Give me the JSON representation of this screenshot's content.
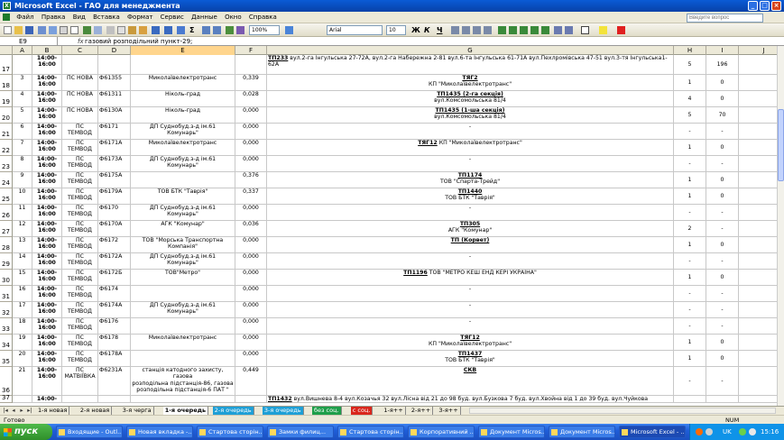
{
  "window": {
    "title": "Microsoft Excel - ГАО для менеджмента",
    "min_glyph": "_",
    "max_glyph": "□",
    "close_glyph": "×"
  },
  "menu": {
    "items": [
      "Файл",
      "Правка",
      "Вид",
      "Вставка",
      "Формат",
      "Сервис",
      "Данные",
      "Окно",
      "Справка"
    ],
    "help_placeholder": "Введите вопрос"
  },
  "toolbar": {
    "zoom": "100%",
    "font_name": "Arial",
    "font_size": "10",
    "bold": "Ж",
    "italic": "К",
    "underline": "Ч"
  },
  "formula_bar": {
    "cell_ref": "E9",
    "fx": "fx",
    "formula": "газовий розподільний пункт-29;"
  },
  "columns": [
    "A",
    "B",
    "C",
    "D",
    "E",
    "F",
    "G",
    "H",
    "I",
    "J"
  ],
  "selected_column": "E",
  "rows": [
    {
      "n": "17",
      "a": "",
      "b": "14:00-\n16:00",
      "c": "",
      "d": "",
      "e": "",
      "f": "",
      "g_b": "ТП233",
      "g": " вул.2-га Інгульська 27-72А, вул.2-га Набережна 2-81 вул.6-та Інгульська 61-71А вул.Пехлромівська 47-51 вул.3-тя Інгульська1-62А",
      "h": "5",
      "i": "196"
    },
    {
      "n": "18",
      "a": "3",
      "b": "14:00-\n16:00",
      "c": "ПС НОВА",
      "d": "Ф61355",
      "e": "Миколаївелектротранс",
      "f": "0,339",
      "g_b": "ТЯГ2",
      "g": "КП \"Миколаївелектротранс\"",
      "h": "1",
      "i": "0"
    },
    {
      "n": "19",
      "a": "4",
      "b": "14:00-\n16:00",
      "c": "ПС НОВА",
      "d": "Ф61311",
      "e": "Ніколь-град",
      "f": "0,028",
      "g_b": "ТП1435 (2-га секція)",
      "g": "вул.Комсомольська 81/4",
      "h": "4",
      "i": "0"
    },
    {
      "n": "20",
      "a": "5",
      "b": "14:00-\n16:00",
      "c": "ПС НОВА",
      "d": "Ф6130А",
      "e": "Ніколь-град",
      "f": "0,000",
      "g_b": "ТП1435 (1-ша секція)",
      "g": "вул.Комсомольська 81/4",
      "h": "5",
      "i": "70"
    },
    {
      "n": "21",
      "a": "6",
      "b": "14:00-\n16:00",
      "c": "ПС\nТЕМВОД",
      "d": "Ф6171",
      "e": "ДП Суднобуд.з-д ім.61\nКомунарь\"",
      "f": "0,000",
      "g_b": "",
      "g": "-",
      "h": "-",
      "i": "-"
    },
    {
      "n": "22",
      "a": "7",
      "b": "14:00-\n16:00",
      "c": "ПС\nТЕМВОД",
      "d": "Ф6171А",
      "e": "Миколаївелектротранс",
      "f": "0,000",
      "g_b": "ТЯГ12",
      "g": " КП \"Миколаївелектротранс\"",
      "h": "1",
      "i": "0"
    },
    {
      "n": "23",
      "a": "8",
      "b": "14:00-\n16:00",
      "c": "ПС\nТЕМВОД",
      "d": "Ф6173А",
      "e": "ДП Суднобуд.з-д ім.61\nКомунарь\"",
      "f": "0,000",
      "g_b": "",
      "g": "-",
      "h": "-",
      "i": "-"
    },
    {
      "n": "24",
      "a": "9",
      "b": "14:00-\n16:00",
      "c": "ПС\nТЕМВОД",
      "d": "Ф6175А",
      "e": "",
      "f": "0,376",
      "g_b": "ТП1174",
      "g": "ТОВ \"Спарта-Трейд\"",
      "h": "1",
      "i": "0"
    },
    {
      "n": "25",
      "a": "10",
      "b": "14:00-\n16:00",
      "c": "ПС\nТЕМВОД",
      "d": "Ф6179А",
      "e": "ТОВ БТК \"Таврія\"",
      "f": "0,337",
      "g_b": "ТП1440",
      "g": "ТОВ БТК \"Таврія\"",
      "h": "1",
      "i": "0"
    },
    {
      "n": "26",
      "a": "11",
      "b": "14:00-\n16:00",
      "c": "ПС\nТЕМВОД",
      "d": "Ф6170",
      "e": "ДП Суднобуд.з-д ім.61\nКомунарь\"",
      "f": "0,000",
      "g_b": "",
      "g": "-",
      "h": "-",
      "i": "-"
    },
    {
      "n": "27",
      "a": "12",
      "b": "14:00-\n16:00",
      "c": "ПС\nТЕМВОД",
      "d": "Ф6170А",
      "e": "АГК \"Комунар\"",
      "f": "0,036",
      "g_b": "ТП305",
      "g": "АГК \"Комунар\"",
      "h": "2",
      "i": "-"
    },
    {
      "n": "28",
      "a": "13",
      "b": "14:00-\n16:00",
      "c": "ПС\nТЕМВОД",
      "d": "Ф6172",
      "e": "ТОВ \"Морська Транспортна\nКомпанія\"",
      "f": "0,000",
      "g_b": "ТП (Корвет)",
      "g": "",
      "h": "1",
      "i": "0"
    },
    {
      "n": "29",
      "a": "14",
      "b": "14:00-\n16:00",
      "c": "ПС\nТЕМВОД",
      "d": "Ф6172А",
      "e": "ДП Суднобуд.з-д ім.61\nКомунарь\"",
      "f": "0,000",
      "g_b": "",
      "g": "-",
      "h": "-",
      "i": "-"
    },
    {
      "n": "30",
      "a": "15",
      "b": "14:00-\n16:00",
      "c": "ПС\nТЕМВОД",
      "d": "Ф6172Б",
      "e": "ТОВ\"Метро\"",
      "f": "0,000",
      "g_b": "ТП1196",
      "g": " ТОВ \"МЕТРО КЕШ ЕНД КЕРІ УКРАЇНА\"",
      "h": "1",
      "i": "0"
    },
    {
      "n": "31",
      "a": "16",
      "b": "14:00-\n16:00",
      "c": "ПС\nТЕМВОД",
      "d": "Ф6174",
      "e": "",
      "f": "0,000",
      "g_b": "",
      "g": "-",
      "h": "-",
      "i": "-"
    },
    {
      "n": "32",
      "a": "17",
      "b": "14:00-\n16:00",
      "c": "ПС\nТЕМВОД",
      "d": "Ф6174А",
      "e": "ДП Суднобуд.з-д ім.61\nКомунарь\"",
      "f": "0,000",
      "g_b": "",
      "g": "-",
      "h": "-",
      "i": "-"
    },
    {
      "n": "33",
      "a": "18",
      "b": "14:00-\n16:00",
      "c": "ПС\nТЕМВОД",
      "d": "Ф6176",
      "e": "",
      "f": "0,000",
      "g_b": "",
      "g": "-",
      "h": "-",
      "i": "-"
    },
    {
      "n": "34",
      "a": "19",
      "b": "14:00-\n16:00",
      "c": "ПС\nТЕМВОД",
      "d": "Ф6178",
      "e": "Миколаївелектротранс",
      "f": "0,000",
      "g_b": "ТЯГ12",
      "g": "КП \"Миколаївелектротранс\"",
      "h": "1",
      "i": "0"
    },
    {
      "n": "35",
      "a": "20",
      "b": "14:00-\n16:00",
      "c": "ПС\nТЕМВОД",
      "d": "Ф6178А",
      "e": "",
      "f": "0,000",
      "g_b": "ТП1437",
      "g": "ТОВ БТК \"Таврія\"",
      "h": "1",
      "i": "0"
    },
    {
      "n": "36",
      "a": "21",
      "b": "14:00-\n16:00",
      "c": "ПС\nМАТВІЇВКА",
      "d": "Ф6231А",
      "e": "станція катодного захисту, газова\nрозподільна підстанція-86, газова\nрозподільна підстанція-6 ПАТ \"",
      "f": "0,449",
      "g_b": "СКВ",
      "g": "",
      "h": "-",
      "i": "-"
    },
    {
      "n": "37",
      "a": "",
      "b": "14:00-",
      "c": "",
      "d": "",
      "e": "",
      "f": "",
      "g_b": "ТП1432",
      "g": " вул.Вишнева 8-4 вул.Козачья 32 вул.Лісна від 21 до 98 буд. вул.Бузкова 7 буд. вул.Хвойна від 1 до 39 буд. вул.Чуйкова",
      "h": "",
      "i": ""
    }
  ],
  "sheet_tabs": [
    "1-я новая",
    "2-я новая",
    "3-я черга",
    "1-я очередь",
    "2-я очередь",
    "3-я очередь",
    "без соц.",
    "с соц.",
    "1-я++",
    "2-я++",
    "3-я++"
  ],
  "active_tab": "1-я очередь",
  "tab_colors": {
    "2-я очередь": "#1e9fd6",
    "3-я очередь": "#1e9fd6",
    "без соц.": "#1e9e4a",
    "с соц.": "#d9261c"
  },
  "status": {
    "left": "Готово",
    "num": "NUM"
  },
  "taskbar": {
    "start": "пуск",
    "tasks": [
      "Входящие - Outl...",
      "Новая вкладка -...",
      "Стартова сторін...",
      "Замки филиц...",
      "Стартова сторін...",
      "Корпоративний ...",
      "Документ Micros...",
      "Документ Micros...",
      "Microsoft Excel - ..."
    ],
    "active_task": "Microsoft Excel - ...",
    "lang": "UK",
    "clock": "15:16"
  }
}
